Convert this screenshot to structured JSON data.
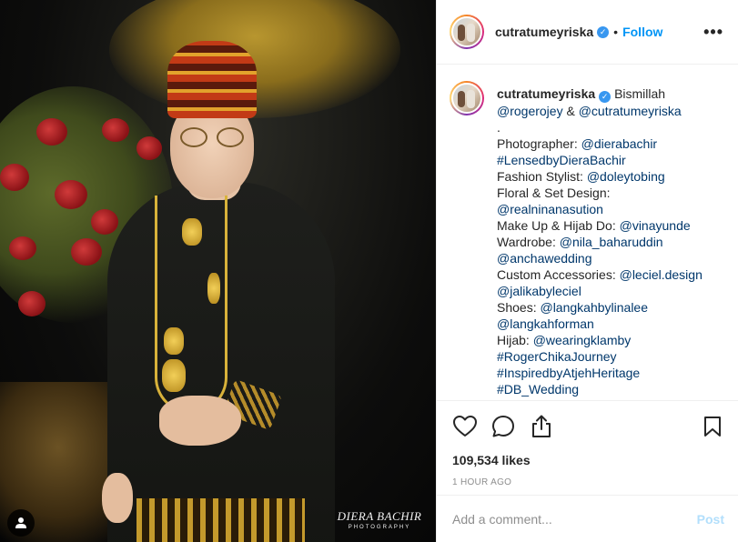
{
  "post": {
    "photo_watermark": {
      "main": "DIERA BACHIR",
      "sub": "PHOTOGRAPHY"
    },
    "icons": {
      "user_tag": "user-tag-icon",
      "verified": "verified-badge-icon",
      "more": "more-options-icon",
      "like": "heart-icon",
      "comment": "comment-icon",
      "share": "share-icon",
      "save": "bookmark-icon"
    }
  },
  "header": {
    "username": "cutratumeyriska",
    "separator": "•",
    "follow_label": "Follow",
    "more_label": "•••"
  },
  "caption": {
    "username": "cutratumeyriska",
    "lines": [
      {
        "parts": [
          {
            "text": "Bismillah",
            "type": "text"
          }
        ],
        "after_user": true
      },
      {
        "parts": [
          {
            "text": "@rogerojey",
            "type": "link"
          },
          {
            "text": " & ",
            "type": "text"
          },
          {
            "text": "@cutratumeyriska",
            "type": "link"
          }
        ]
      },
      {
        "parts": [
          {
            "text": ".",
            "type": "text"
          }
        ]
      },
      {
        "parts": [
          {
            "text": "Photographer: ",
            "type": "text"
          },
          {
            "text": "@dierabachir",
            "type": "link"
          }
        ]
      },
      {
        "parts": [
          {
            "text": "#LensedbyDieraBachir",
            "type": "link"
          }
        ]
      },
      {
        "parts": [
          {
            "text": "Fashion Stylist: ",
            "type": "text"
          },
          {
            "text": "@doleytobing",
            "type": "link"
          }
        ]
      },
      {
        "parts": [
          {
            "text": "Floral & Set Design:",
            "type": "text"
          }
        ]
      },
      {
        "parts": [
          {
            "text": "@realninanasution",
            "type": "link"
          }
        ]
      },
      {
        "parts": [
          {
            "text": "Make Up & Hijab Do: ",
            "type": "text"
          },
          {
            "text": "@vinayunde",
            "type": "link"
          }
        ]
      },
      {
        "parts": [
          {
            "text": "Wardrobe: ",
            "type": "text"
          },
          {
            "text": "@nila_baharuddin",
            "type": "link"
          }
        ]
      },
      {
        "parts": [
          {
            "text": "@anchawedding",
            "type": "link"
          }
        ]
      },
      {
        "parts": [
          {
            "text": "Custom Accessories: ",
            "type": "text"
          },
          {
            "text": "@leciel.design",
            "type": "link"
          }
        ]
      },
      {
        "parts": [
          {
            "text": "@jalikabyleciel",
            "type": "link"
          }
        ]
      },
      {
        "parts": [
          {
            "text": "Shoes: ",
            "type": "text"
          },
          {
            "text": "@langkahbylinalee",
            "type": "link"
          }
        ]
      },
      {
        "parts": [
          {
            "text": "@langkahforman",
            "type": "link"
          }
        ]
      },
      {
        "parts": [
          {
            "text": "Hijab: ",
            "type": "text"
          },
          {
            "text": "@wearingklamby",
            "type": "link"
          }
        ]
      },
      {
        "parts": [
          {
            "text": "#RogerChikaJourney",
            "type": "link"
          }
        ]
      },
      {
        "parts": [
          {
            "text": "#InspiredbyAtjehHeritage",
            "type": "link"
          }
        ]
      },
      {
        "parts": [
          {
            "text": "#DB_Wedding",
            "type": "link"
          }
        ]
      }
    ]
  },
  "stats": {
    "likes": "109,534 likes",
    "time": "1 HOUR AGO"
  },
  "comment": {
    "placeholder": "Add a comment...",
    "post_label": "Post"
  },
  "colors": {
    "link": "#00376b",
    "follow": "#0095f6",
    "post_disabled": "#b2dffc",
    "verified": "#3897f0",
    "muted": "#8e8e8e"
  }
}
